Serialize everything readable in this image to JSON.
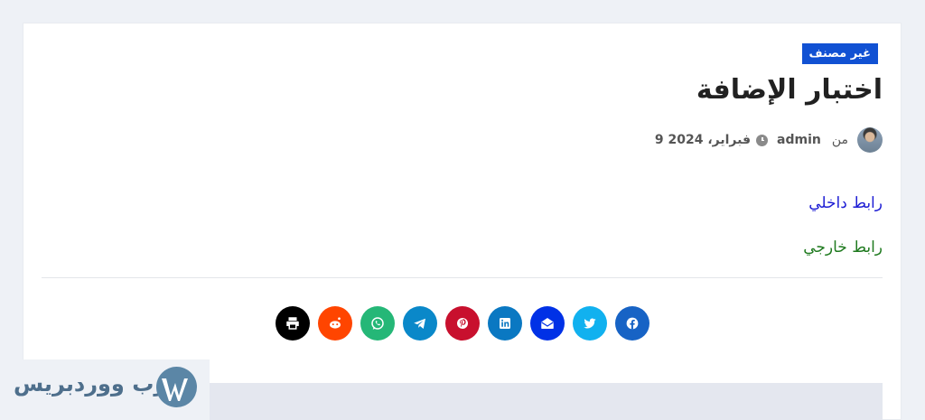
{
  "post": {
    "category": "غير مصنف",
    "title": "اختبار الإضافة",
    "meta": {
      "by_label": "من",
      "author": "admin",
      "date": "9 فبراير، 2024"
    },
    "content": {
      "internal_link": "رابط داخلي",
      "external_link": "رابط خارجي"
    }
  },
  "share": {
    "buttons": [
      {
        "name": "print",
        "icon": "print-icon",
        "color": "#000000"
      },
      {
        "name": "reddit",
        "icon": "reddit-icon",
        "color": "#ff4500"
      },
      {
        "name": "whatsapp",
        "icon": "whatsapp-icon",
        "color": "#25b777"
      },
      {
        "name": "telegram",
        "icon": "telegram-icon",
        "color": "#0a88c9"
      },
      {
        "name": "pinterest",
        "icon": "pinterest-icon",
        "color": "#c8102e"
      },
      {
        "name": "linkedin",
        "icon": "linkedin-icon",
        "color": "#0a78c2"
      },
      {
        "name": "email",
        "icon": "email-icon",
        "color": "#0031e6"
      },
      {
        "name": "twitter",
        "icon": "twitter-icon",
        "color": "#11b1ef"
      },
      {
        "name": "facebook",
        "icon": "facebook-icon",
        "color": "#1763c5"
      }
    ]
  },
  "watermark": {
    "text": "عرب ووردبريس"
  },
  "colors": {
    "category_bg": "#1151d3",
    "internal_link": "#1d1dd4",
    "external_link": "#1f7a1f",
    "page_bg": "#eef1f6"
  }
}
